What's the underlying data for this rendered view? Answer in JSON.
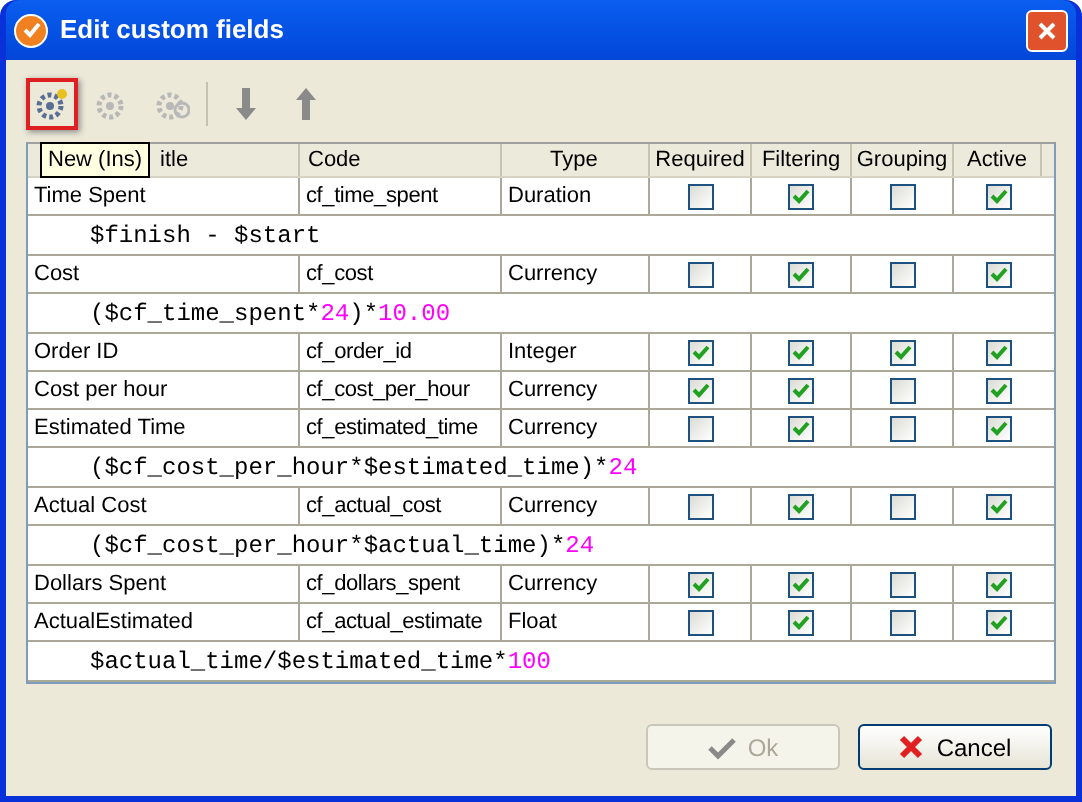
{
  "window": {
    "title": "Edit custom fields"
  },
  "toolbar": [
    {
      "kind": "new",
      "selected": true,
      "disabled": false
    },
    {
      "kind": "edit",
      "selected": false,
      "disabled": true
    },
    {
      "kind": "delete",
      "selected": false,
      "disabled": true
    },
    {
      "kind": "down",
      "selected": false,
      "disabled": false
    },
    {
      "kind": "up",
      "selected": false,
      "disabled": false
    }
  ],
  "tooltip": "New (Ins)",
  "table": {
    "columns": [
      "itle",
      "Code",
      "Type",
      "Required",
      "Filtering",
      "Grouping",
      "Active"
    ],
    "rows": [
      {
        "kind": "field",
        "title": "Time Spent",
        "code": "cf_time_spent",
        "type": "Duration",
        "required": false,
        "filtering": true,
        "grouping": false,
        "active": true
      },
      {
        "kind": "formula",
        "parts": [
          {
            "kind": "plain",
            "text": "$finish - $start"
          }
        ]
      },
      {
        "kind": "field",
        "title": "Cost",
        "code": "cf_cost",
        "type": "Currency",
        "required": false,
        "filtering": true,
        "grouping": false,
        "active": true
      },
      {
        "kind": "formula",
        "parts": [
          {
            "kind": "plain",
            "text": "($cf_time_spent*"
          },
          {
            "kind": "number",
            "text": "24"
          },
          {
            "kind": "plain",
            "text": ")*"
          },
          {
            "kind": "number",
            "text": "10.00"
          }
        ]
      },
      {
        "kind": "field",
        "title": "Order ID",
        "code": "cf_order_id",
        "type": "Integer",
        "required": true,
        "filtering": true,
        "grouping": true,
        "active": true
      },
      {
        "kind": "field",
        "title": "Cost per hour",
        "code": "cf_cost_per_hour",
        "type": "Currency",
        "required": true,
        "filtering": true,
        "grouping": false,
        "active": true
      },
      {
        "kind": "field",
        "title": "Estimated Time",
        "code": "cf_estimated_time",
        "type": "Currency",
        "required": false,
        "filtering": true,
        "grouping": false,
        "active": true
      },
      {
        "kind": "formula",
        "parts": [
          {
            "kind": "plain",
            "text": "($cf_cost_per_hour*$estimated_time)*"
          },
          {
            "kind": "number",
            "text": "24"
          }
        ]
      },
      {
        "kind": "field",
        "title": "Actual Cost",
        "code": "cf_actual_cost",
        "type": "Currency",
        "required": false,
        "filtering": true,
        "grouping": false,
        "active": true
      },
      {
        "kind": "formula",
        "parts": [
          {
            "kind": "plain",
            "text": "($cf_cost_per_hour*$actual_time)*"
          },
          {
            "kind": "number",
            "text": "24"
          }
        ]
      },
      {
        "kind": "field",
        "title": "Dollars Spent",
        "code": "cf_dollars_spent",
        "type": "Currency",
        "required": true,
        "filtering": true,
        "grouping": false,
        "active": true
      },
      {
        "kind": "field",
        "title": "ActualEstimated",
        "code": "cf_actual_estimate",
        "type": "Float",
        "required": false,
        "filtering": true,
        "grouping": false,
        "active": true
      },
      {
        "kind": "formula",
        "parts": [
          {
            "kind": "plain",
            "text": "$actual_time/$estimated_time*"
          },
          {
            "kind": "number",
            "text": "100"
          }
        ]
      }
    ]
  },
  "buttons": [
    {
      "kind": "ok",
      "label": "Ok",
      "disabled": true
    },
    {
      "kind": "cancel",
      "label": "Cancel",
      "disabled": false
    }
  ]
}
